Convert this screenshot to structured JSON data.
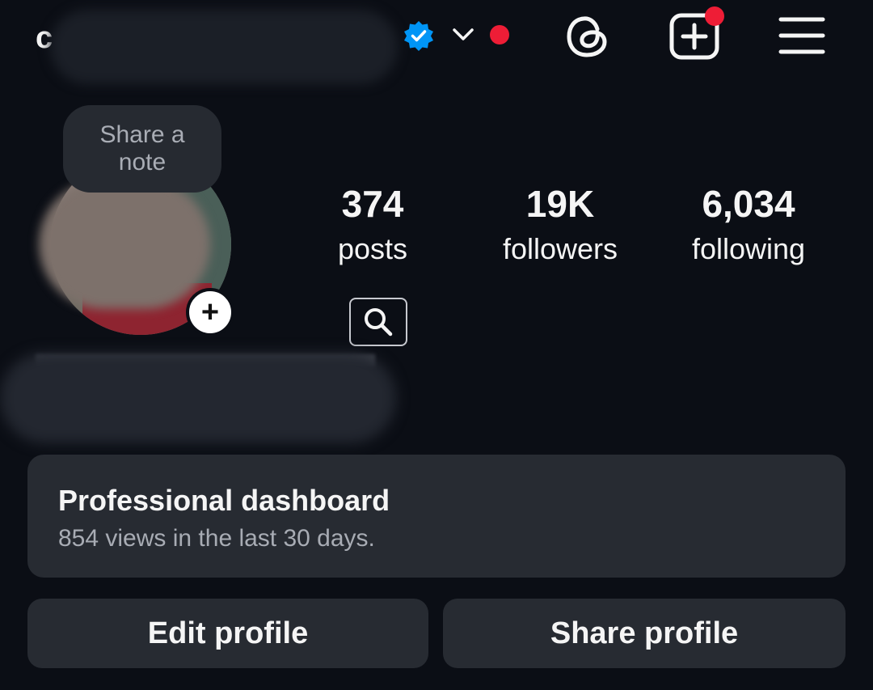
{
  "header": {
    "username_visible": "c",
    "icons": {
      "verified": "verified-badge-icon",
      "chevron": "chevron-down-icon",
      "threads": "threads-icon",
      "create": "plus-square-icon",
      "menu": "hamburger-menu-icon"
    },
    "accent_color": "#0095f6",
    "notification_color": "#ee1d36"
  },
  "note": {
    "text": "Share a note"
  },
  "stats": [
    {
      "value": "374",
      "label": "posts"
    },
    {
      "value": "19K",
      "label": "followers"
    },
    {
      "value": "6,034",
      "label": "following"
    }
  ],
  "dashboard": {
    "title": "Professional dashboard",
    "subtitle": "854 views in the last 30 days."
  },
  "actions": {
    "edit_label": "Edit profile",
    "share_label": "Share profile"
  }
}
